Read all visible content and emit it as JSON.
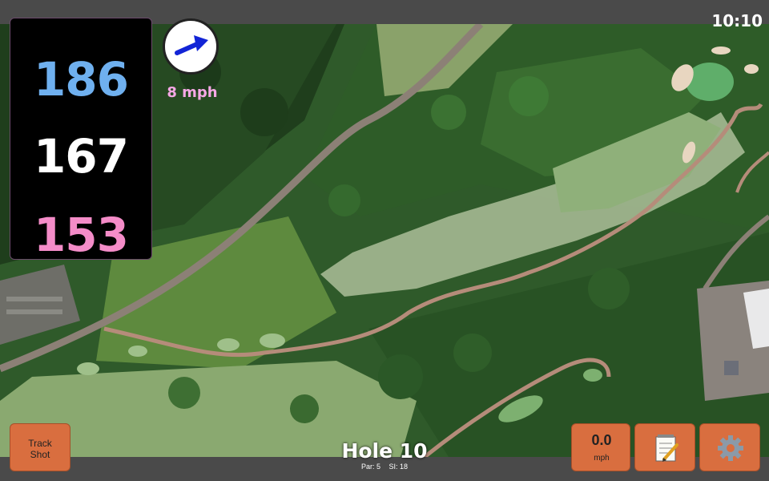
{
  "status_bar": {
    "time": "10:10"
  },
  "distances": {
    "back": {
      "value": "186",
      "color": "#6fb0ef"
    },
    "middle": {
      "value": "167",
      "color": "#ffffff"
    },
    "front": {
      "value": "153",
      "color": "#f48cc8"
    }
  },
  "wind": {
    "speed": "8 mph",
    "direction_icon": "arrow-right-up-icon",
    "speed_color": "#f6a8e6"
  },
  "controls": {
    "track_shot": {
      "line1": "Track",
      "line2": "Shot"
    },
    "shot_speed": {
      "value": "0.0",
      "unit": "mph"
    },
    "notes_icon": "notepad-icon",
    "settings_icon": "gear-icon",
    "button_color": "#d96e3f"
  },
  "hole": {
    "title": "Hole 10",
    "par": "Par: 5",
    "stroke_index": "SI: 18"
  }
}
